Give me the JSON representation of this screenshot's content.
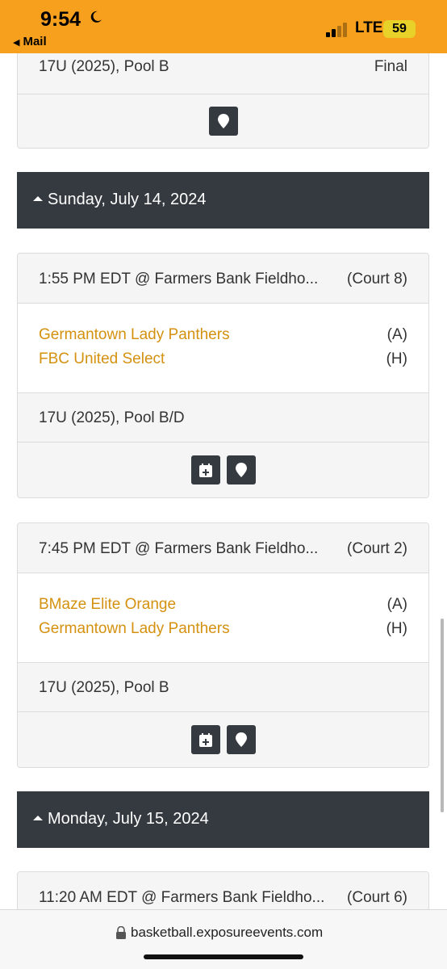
{
  "status_bar": {
    "time": "9:54",
    "back_label": "Mail",
    "network": "LTE",
    "battery": "59",
    "colors": {
      "background": "#f7a01d",
      "battery": "#e8d22a"
    }
  },
  "colors": {
    "team_link": "#d4910f",
    "day_header": "#343a40",
    "card_gray": "#f5f5f5"
  },
  "prev_game": {
    "division": "17U (2025), Pool B",
    "result": "Final",
    "actions": [
      "location-icon"
    ]
  },
  "days": [
    {
      "date": "Sunday, July 14, 2024",
      "games": [
        {
          "time_venue": "1:55 PM EDT @ Farmers Bank Fieldho...",
          "court": "(Court 8)",
          "home_away": [
            {
              "team": "Germantown Lady Panthers",
              "side": "(A)"
            },
            {
              "team": "FBC United Select",
              "side": "(H)"
            }
          ],
          "division": "17U (2025), Pool B/D",
          "actions": [
            "add-to-calendar-icon",
            "location-icon"
          ]
        },
        {
          "time_venue": "7:45 PM EDT @ Farmers Bank Fieldho...",
          "court": "(Court 2)",
          "home_away": [
            {
              "team": "BMaze Elite Orange",
              "side": "(A)"
            },
            {
              "team": "Germantown Lady Panthers",
              "side": "(H)"
            }
          ],
          "division": "17U (2025), Pool B",
          "actions": [
            "add-to-calendar-icon",
            "location-icon"
          ]
        }
      ]
    },
    {
      "date": "Monday, July 15, 2024",
      "games": [
        {
          "time_venue": "11:20 AM EDT @ Farmers Bank Fieldho...",
          "court": "(Court 6)"
        }
      ]
    }
  ],
  "url_bar": {
    "url": "basketball.exposureevents.com"
  }
}
